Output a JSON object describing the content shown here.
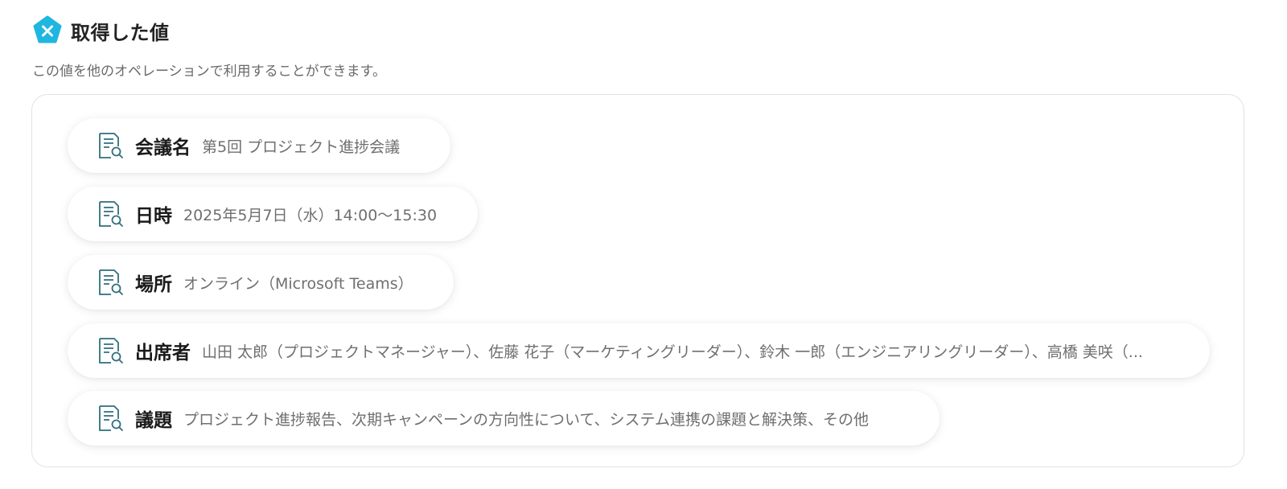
{
  "header": {
    "title": "取得した値",
    "icon": "variable-x-icon",
    "icon_color": "#1fb6e0"
  },
  "description": "この値を他のオペレーションで利用することができます。",
  "fields": [
    {
      "label": "会議名",
      "value": "第5回 プロジェクト進捗会議",
      "icon": "document-search-icon"
    },
    {
      "label": "日時",
      "value": "2025年5月7日（水）14:00〜15:30",
      "icon": "document-search-icon"
    },
    {
      "label": "場所",
      "value": "オンライン（Microsoft Teams）",
      "icon": "document-search-icon"
    },
    {
      "label": "出席者",
      "value": "山田 太郎（プロジェクトマネージャー）、佐藤 花子（マーケティングリーダー）、鈴木 一郎（エンジニアリングリーダー）、高橋 美咲（...",
      "icon": "document-search-icon"
    },
    {
      "label": "議題",
      "value": "プロジェクト進捗報告、次期キャンペーンの方向性について、システム連携の課題と解決策、その他",
      "icon": "document-search-icon"
    }
  ],
  "colors": {
    "icon_stroke": "#2f6f7e",
    "label_text": "#1a1a1a",
    "value_text": "#6f6f6f"
  }
}
